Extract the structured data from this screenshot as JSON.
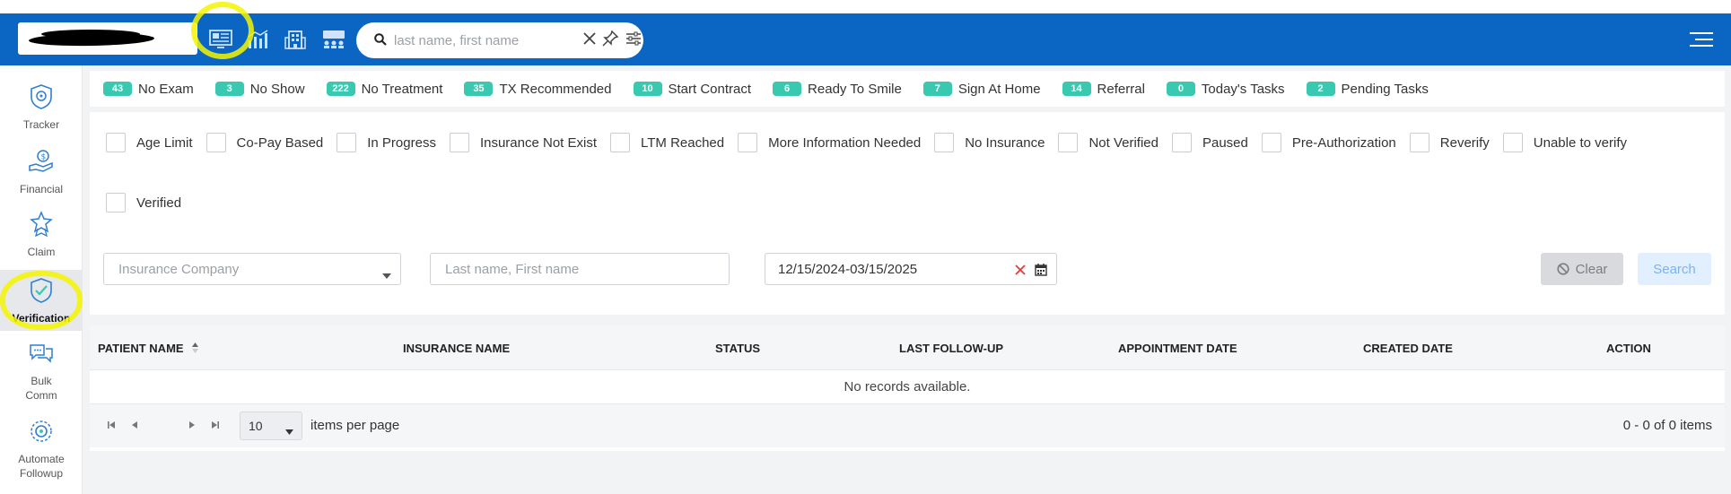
{
  "search": {
    "placeholder": "last name, first name"
  },
  "sidebar": {
    "items": [
      {
        "label": "Tracker",
        "icon": "tracker-icon"
      },
      {
        "label": "Financial",
        "icon": "financial-icon"
      },
      {
        "label": "Claim",
        "icon": "claim-icon"
      },
      {
        "label": "Verification",
        "icon": "verification-icon"
      },
      {
        "label": "Bulk\nComm",
        "icon": "bulk-comm-icon"
      },
      {
        "label": "Automate\nFollowup",
        "icon": "automate-followup-icon"
      }
    ]
  },
  "chips": [
    {
      "count": "43",
      "label": "No Exam"
    },
    {
      "count": "3",
      "label": "No Show"
    },
    {
      "count": "222",
      "label": "No Treatment"
    },
    {
      "count": "35",
      "label": "TX Recommended"
    },
    {
      "count": "10",
      "label": "Start Contract"
    },
    {
      "count": "6",
      "label": "Ready To Smile"
    },
    {
      "count": "7",
      "label": "Sign At Home"
    },
    {
      "count": "14",
      "label": "Referral"
    },
    {
      "count": "0",
      "label": "Today's Tasks"
    },
    {
      "count": "2",
      "label": "Pending Tasks"
    }
  ],
  "statuses": [
    "Age Limit",
    "Co-Pay Based",
    "In Progress",
    "Insurance Not Exist",
    "LTM Reached",
    "More Information Needed",
    "No Insurance",
    "Not Verified",
    "Paused",
    "Pre-Authorization",
    "Reverify",
    "Unable to verify",
    "Verified"
  ],
  "filters": {
    "insurance_placeholder": "Insurance Company",
    "name_placeholder": "Last name, First name",
    "date_range": "12/15/2024-03/15/2025",
    "clear_label": "Clear",
    "search_label": "Search"
  },
  "grid": {
    "columns": [
      "PATIENT NAME",
      "INSURANCE NAME",
      "STATUS",
      "LAST FOLLOW-UP",
      "APPOINTMENT DATE",
      "CREATED DATE",
      "ACTION"
    ],
    "empty": "No records available.",
    "page_size": "10",
    "items_per_page": "items per page",
    "range": "0 - 0 of 0 items"
  },
  "colors": {
    "topbar": "#0a66c2",
    "accent": "#39c9b0",
    "highlight": "#f5f500"
  }
}
